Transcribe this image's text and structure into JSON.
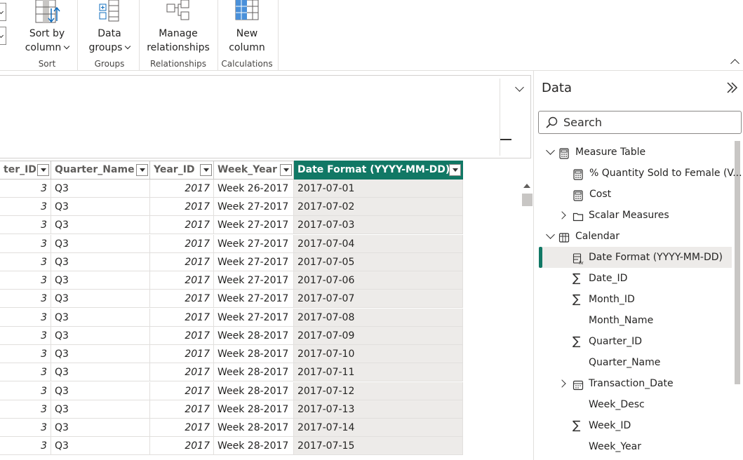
{
  "ribbon": {
    "sort_by_column": {
      "line1": "Sort by",
      "line2": "column"
    },
    "data_groups": {
      "line1": "Data",
      "line2": "groups"
    },
    "manage_relationships": {
      "line1": "Manage",
      "line2": "relationships"
    },
    "new_column": {
      "line1": "New",
      "line2": "column"
    },
    "group_labels": {
      "sort": "Sort",
      "groups": "Groups",
      "relationships": "Relationships",
      "calculations": "Calculations"
    }
  },
  "grid": {
    "columns": [
      "ter_ID",
      "Quarter_Name",
      "Year_ID",
      "Week_Year",
      "Date Format (YYYY-MM-DD)"
    ],
    "rows": [
      [
        "3",
        "Q3",
        "2017",
        "Week 26-2017",
        "2017-07-01"
      ],
      [
        "3",
        "Q3",
        "2017",
        "Week 27-2017",
        "2017-07-02"
      ],
      [
        "3",
        "Q3",
        "2017",
        "Week 27-2017",
        "2017-07-03"
      ],
      [
        "3",
        "Q3",
        "2017",
        "Week 27-2017",
        "2017-07-04"
      ],
      [
        "3",
        "Q3",
        "2017",
        "Week 27-2017",
        "2017-07-05"
      ],
      [
        "3",
        "Q3",
        "2017",
        "Week 27-2017",
        "2017-07-06"
      ],
      [
        "3",
        "Q3",
        "2017",
        "Week 27-2017",
        "2017-07-07"
      ],
      [
        "3",
        "Q3",
        "2017",
        "Week 27-2017",
        "2017-07-08"
      ],
      [
        "3",
        "Q3",
        "2017",
        "Week 28-2017",
        "2017-07-09"
      ],
      [
        "3",
        "Q3",
        "2017",
        "Week 28-2017",
        "2017-07-10"
      ],
      [
        "3",
        "Q3",
        "2017",
        "Week 28-2017",
        "2017-07-11"
      ],
      [
        "3",
        "Q3",
        "2017",
        "Week 28-2017",
        "2017-07-12"
      ],
      [
        "3",
        "Q3",
        "2017",
        "Week 28-2017",
        "2017-07-13"
      ],
      [
        "3",
        "Q3",
        "2017",
        "Week 28-2017",
        "2017-07-14"
      ],
      [
        "3",
        "Q3",
        "2017",
        "Week 28-2017",
        "2017-07-15"
      ]
    ]
  },
  "data_pane": {
    "title": "Data",
    "search_placeholder": "Search",
    "items": [
      {
        "label": "Measure Table",
        "icon": "table-calculator-icon",
        "expanded": true
      },
      {
        "label": "% Quantity Sold to Female (V...",
        "icon": "calculator-icon"
      },
      {
        "label": "Cost",
        "icon": "calculator-icon"
      },
      {
        "label": "Scalar Measures",
        "icon": "folder-icon",
        "expanded": false
      },
      {
        "label": "Calendar",
        "icon": "table-icon",
        "expanded": true
      },
      {
        "label": "Date Format (YYYY-MM-DD)",
        "icon": "calculated-column-icon",
        "selected": true
      },
      {
        "label": "Date_ID",
        "icon": "sigma-icon"
      },
      {
        "label": "Month_ID",
        "icon": "sigma-icon"
      },
      {
        "label": "Month_Name",
        "icon": ""
      },
      {
        "label": "Quarter_ID",
        "icon": "sigma-icon"
      },
      {
        "label": "Quarter_Name",
        "icon": ""
      },
      {
        "label": "Transaction_Date",
        "icon": "calendar-icon",
        "expanded": false
      },
      {
        "label": "Week_Desc",
        "icon": ""
      },
      {
        "label": "Week_ID",
        "icon": "sigma-icon"
      },
      {
        "label": "Week_Year",
        "icon": ""
      }
    ]
  },
  "colors": {
    "accent": "#117865",
    "selected_cell": "#edebe9"
  }
}
